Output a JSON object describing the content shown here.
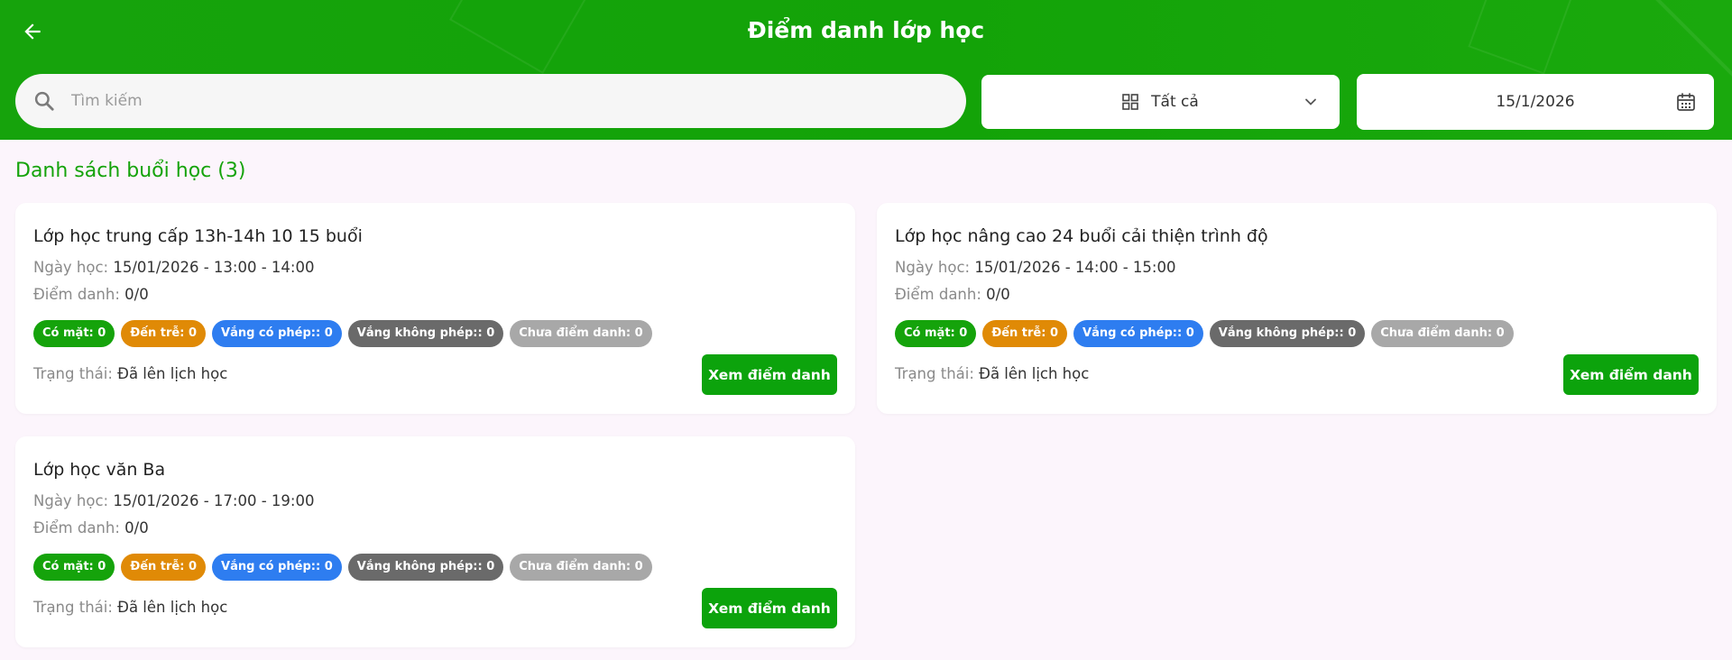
{
  "header": {
    "title": "Điểm danh lớp học",
    "back_icon": "arrow-left-icon"
  },
  "search": {
    "placeholder": "Tìm kiếm",
    "value": ""
  },
  "filter": {
    "selected": "Tất cả"
  },
  "date": {
    "value": "15/1/2026"
  },
  "list": {
    "title": "Danh sách buổi học (3)",
    "labels": {
      "date": "Ngày học:",
      "attendance": "Điểm danh:",
      "status": "Trạng thái:",
      "view_button": "Xem điểm danh"
    },
    "sessions": [
      {
        "title": "Lớp học trung cấp 13h-14h 10 15 buổi",
        "date": "15/01/2026 - 13:00 - 14:00",
        "attendance": "0/0",
        "badges": {
          "present": "Có mặt: 0",
          "late": "Đến trễ: 0",
          "excused": "Vắng có phép:: 0",
          "unexcused": "Vắng không phép:: 0",
          "none": "Chưa điểm danh: 0"
        },
        "status": "Đã lên lịch học"
      },
      {
        "title": "Lớp học nâng cao 24 buổi cải thiện trình độ",
        "date": "15/01/2026 - 14:00 - 15:00",
        "attendance": "0/0",
        "badges": {
          "present": "Có mặt: 0",
          "late": "Đến trễ: 0",
          "excused": "Vắng có phép:: 0",
          "unexcused": "Vắng không phép:: 0",
          "none": "Chưa điểm danh: 0"
        },
        "status": "Đã lên lịch học"
      },
      {
        "title": "Lớp học văn Ba",
        "date": "15/01/2026 - 17:00 - 19:00",
        "attendance": "0/0",
        "badges": {
          "present": "Có mặt: 0",
          "late": "Đến trễ: 0",
          "excused": "Vắng có phép:: 0",
          "unexcused": "Vắng không phép:: 0",
          "none": "Chưa điểm danh: 0"
        },
        "status": "Đã lên lịch học"
      }
    ]
  },
  "colors": {
    "brand_green": "#15a30b",
    "late_orange": "#e08a06",
    "excused_blue": "#2e7df0",
    "unexcused_gray": "#6a6a6a",
    "none_gray": "#a8a8a8"
  }
}
